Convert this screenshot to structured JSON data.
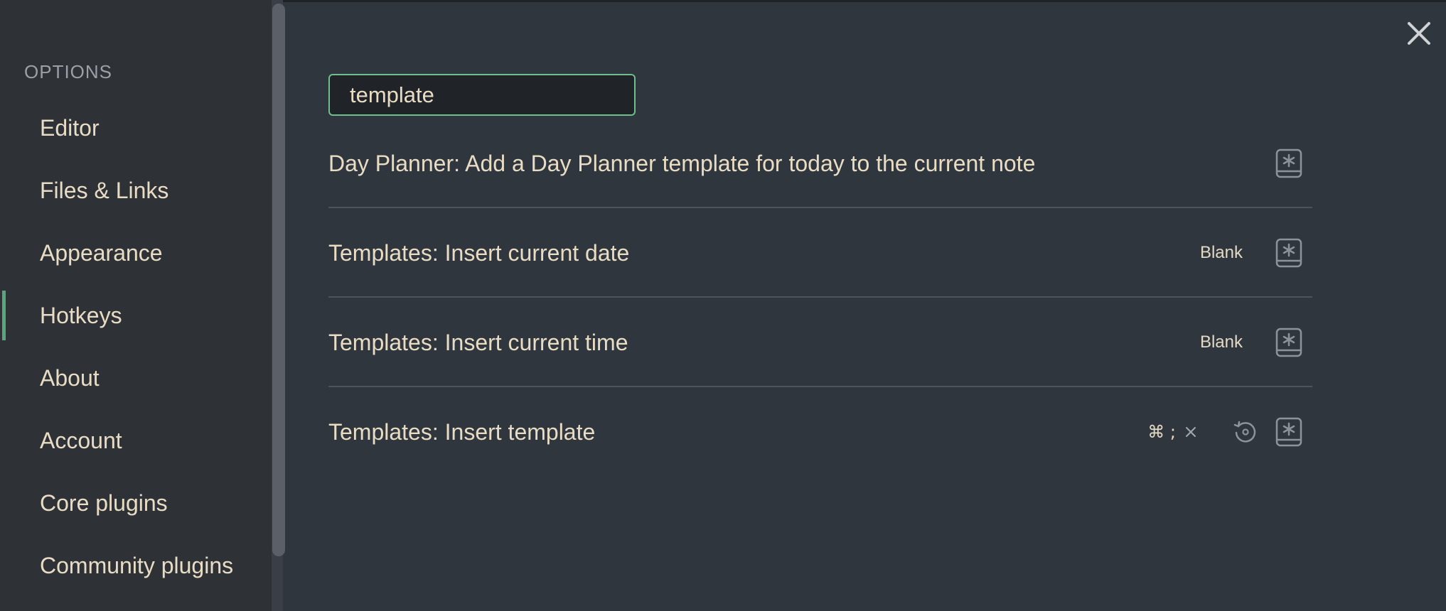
{
  "sidebar": {
    "heading": "OPTIONS",
    "items": [
      {
        "label": "Editor"
      },
      {
        "label": "Files & Links"
      },
      {
        "label": "Appearance"
      },
      {
        "label": "Hotkeys"
      },
      {
        "label": "About"
      },
      {
        "label": "Account"
      },
      {
        "label": "Core plugins"
      },
      {
        "label": "Community plugins"
      }
    ],
    "active_item": "Hotkeys"
  },
  "search": {
    "value": "template",
    "placeholder": ""
  },
  "hotkeys": [
    {
      "command": "Day Planner: Add a Day Planner template for today to the current note",
      "hotkey": ""
    },
    {
      "command": "Templates: Insert current date",
      "hotkey": "Blank"
    },
    {
      "command": "Templates: Insert current time",
      "hotkey": "Blank"
    },
    {
      "command": "Templates: Insert template",
      "hotkey": "⌘ ;"
    }
  ],
  "icons": {
    "close": "close-icon",
    "remove": "remove-hotkey-icon",
    "restore": "restore-default-icon",
    "add": "add-hotkey-icon"
  },
  "colors": {
    "accent": "#57a67c",
    "search_border": "#6fbf8e",
    "text": "#e8dcc4",
    "background": "#30363d"
  }
}
